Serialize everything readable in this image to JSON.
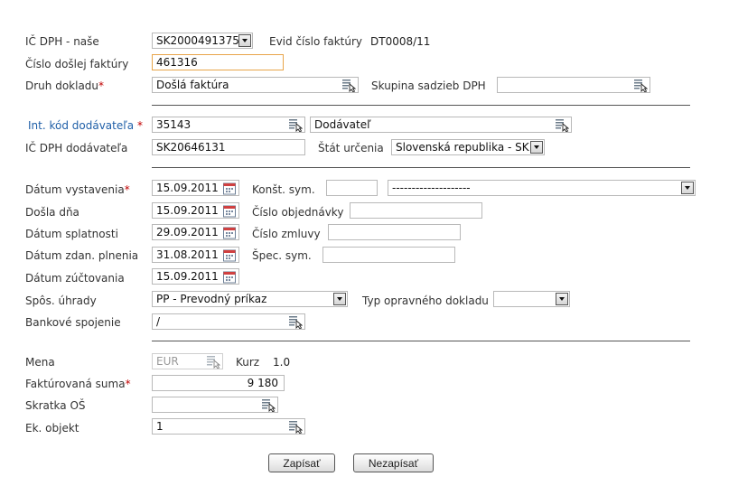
{
  "row1": {
    "ic_dph_label": "IČ DPH - naše",
    "ic_dph_value": "SK2000491375",
    "evid_label": "Evid číslo faktúry",
    "evid_value": "DT0008/11"
  },
  "cislo_faktury": {
    "label": "Číslo došlej faktúry",
    "value": "461316"
  },
  "druh": {
    "label": "Druh dokladu",
    "value": "Došlá faktúra",
    "skupina_label": "Skupina sadzieb DPH",
    "skupina_value": ""
  },
  "dodavatel": {
    "kod_label": "Int. kód dodávateľa",
    "kod_value": "35143",
    "name_value": "Dodávateľ",
    "ic_dph_label": "IČ DPH dodávateľa",
    "ic_dph_value": "SK20646131",
    "stat_label": "Štát určenia",
    "stat_value": "Slovenská republika - SK"
  },
  "datum_vystavenia": {
    "label": "Dátum vystavenia",
    "value": "15.09.2011",
    "konst_label": "Konšt. sym.",
    "konst_value": "",
    "konst_select": "--------------------"
  },
  "dosla_dna": {
    "label": "Došla dňa",
    "value": "15.09.2011",
    "objednavky_label": "Číslo objednávky",
    "objednavky_value": ""
  },
  "datum_splatnosti": {
    "label": "Dátum splatnosti",
    "value": "29.09.2011",
    "zmluvy_label": "Číslo zmluvy",
    "zmluvy_value": ""
  },
  "datum_zdan": {
    "label": "Dátum zdan. plnenia",
    "value": "31.08.2011",
    "spec_label": "Špec. sym.",
    "spec_value": ""
  },
  "datum_zuct": {
    "label": "Dátum zúčtovania",
    "value": "15.09.2011"
  },
  "uhrada": {
    "label": "Spôs. úhrady",
    "value": "PP - Prevodný príkaz",
    "typ_label": "Typ opravného dokladu",
    "typ_value": ""
  },
  "banka": {
    "label": "Bankové spojenie",
    "value": "/"
  },
  "mena": {
    "label": "Mena",
    "value": "EUR",
    "kurz_label": "Kurz",
    "kurz_value": "1.0"
  },
  "suma": {
    "label": "Faktúrovaná suma",
    "value": "9 180"
  },
  "skratka": {
    "label": "Skratka OŠ",
    "value": ""
  },
  "objekt": {
    "label": "Ek. objekt",
    "value": "1"
  },
  "buttons": {
    "save": "Zapísať",
    "cancel": "Nezapísať"
  },
  "required_mark": "*",
  "icons": {
    "lookup": "lookup-icon",
    "calendar": "calendar-icon",
    "dropdown": "chevron-down-icon"
  },
  "colors": {
    "required": "#c00000",
    "link_label": "#1f5fa8",
    "focus_border": "#e8a54a"
  }
}
